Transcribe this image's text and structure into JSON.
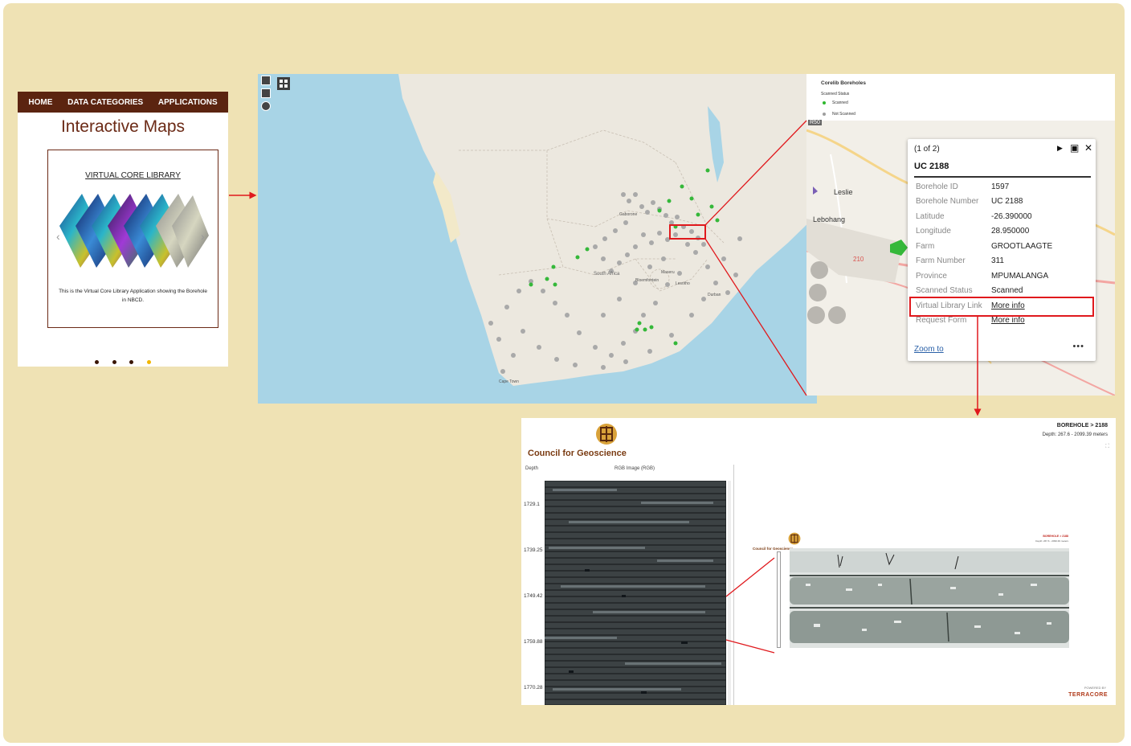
{
  "website": {
    "nav": [
      "HOME",
      "DATA CATEGORIES",
      "APPLICATIONS"
    ],
    "title": "Interactive Maps",
    "card_title": "VIRTUAL CORE LIBRARY",
    "card_description": "This is the Virtual Core Library Application showing the Borehole in NBCD.",
    "carousel_prev_icon": "chevron-left-icon",
    "carousel_next_icon": "chevron-right-icon",
    "slides_total": 4,
    "slide_active": 4
  },
  "map": {
    "labels": [
      "South Africa",
      "Bloemfontein",
      "Cape Town",
      "Durban",
      "Maseru",
      "Gaborone",
      "Lesotho"
    ],
    "controls": [
      "zoom-out-icon",
      "home-icon",
      "locate-icon",
      "grid-icon"
    ]
  },
  "legend": {
    "title": "Corelib Boreholes",
    "subtitle": "Scanned Status",
    "items": [
      {
        "label": "Scanned",
        "color": "#2eb82e"
      },
      {
        "label": "Not Scanned",
        "color": "#9e9e9e"
      }
    ]
  },
  "roads": {
    "r50": "R50",
    "r547": "210",
    "town1": "Leslie",
    "town2": "Lebohang"
  },
  "popup": {
    "counter": "(1 of 2)",
    "title": "UC 2188",
    "fields": [
      {
        "label": "Borehole ID",
        "value": "1597"
      },
      {
        "label": "Borehole Number",
        "value": "UC 2188"
      },
      {
        "label": "Latitude",
        "value": "-26.390000"
      },
      {
        "label": "Longitude",
        "value": "28.950000"
      },
      {
        "label": "Farm",
        "value": "GROOTLAAGTE"
      },
      {
        "label": "Farm Number",
        "value": "311"
      },
      {
        "label": "Province",
        "value": "MPUMALANGA"
      },
      {
        "label": "Scanned Status",
        "value": "Scanned"
      }
    ],
    "virtual_link_label": "Virtual Library Link",
    "virtual_link_text": "More info",
    "request_label": "Request Form",
    "request_text": "More info",
    "zoom_to": "Zoom to",
    "more_menu": "•••"
  },
  "viewer": {
    "org_name": "Council for Geoscience",
    "breadcrumb": "BOREHOLE  >  2188",
    "depth_range": "Depth: 267.6 - 2099.39 meters",
    "col_depth": "Depth",
    "col_image": "RGB Image (RGB)",
    "depths": [
      "1729.1",
      "1739.25",
      "1749.42",
      "1759.88",
      "1770.28"
    ],
    "powered_by": "POWERED BY",
    "brand": "TERRACORE"
  },
  "colors": {
    "page_bg": "#efe2b4",
    "nav_brown": "#5b2410",
    "highlight_red": "#e0191d",
    "scanned_green": "#2eb82e",
    "not_scanned_grey": "#9e9e9e",
    "ocean": "#a8d4e6",
    "land": "#ece8df"
  }
}
